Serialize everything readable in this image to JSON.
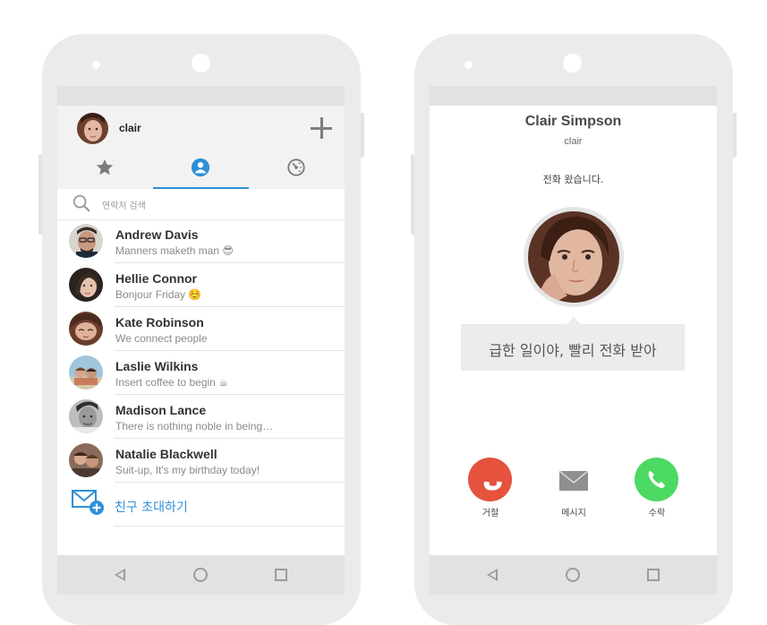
{
  "contacts_screen": {
    "profile": {
      "name": "clair"
    },
    "tabs": [
      {
        "icon": "star-icon",
        "active": false
      },
      {
        "icon": "person-icon",
        "active": true
      },
      {
        "icon": "recent-dial-icon",
        "active": false
      }
    ],
    "search": {
      "placeholder": "연락처 검색"
    },
    "contacts": [
      {
        "name": "Andrew Davis",
        "status": "Manners maketh man 😎"
      },
      {
        "name": "Hellie Connor",
        "status": "Bonjour Friday ☺️"
      },
      {
        "name": "Kate Robinson",
        "status": "We connect people"
      },
      {
        "name": "Laslie Wilkins",
        "status": "Insert coffee to begin ☕"
      },
      {
        "name": "Madison Lance",
        "status": "There is nothing noble in being…"
      },
      {
        "name": "Natalie Blackwell",
        "status": "Suit-up, It's my birthday today!"
      }
    ],
    "invite": {
      "label": "친구 초대하기"
    }
  },
  "call_screen": {
    "caller_name": "Clair Simpson",
    "caller_sub": "clair",
    "incoming_text": "전화 왔습니다.",
    "message": "급한 일이야, 빨리 전화 받아",
    "actions": [
      {
        "label": "거절",
        "icon": "decline-phone-icon",
        "color": "#e5523d"
      },
      {
        "label": "메시지",
        "icon": "envelope-icon",
        "color": "#8f8f8f"
      },
      {
        "label": "수락",
        "icon": "accept-phone-icon",
        "color": "#4cd964"
      }
    ]
  },
  "colors": {
    "accent": "#2f8fd8",
    "decline": "#e5523d",
    "accept": "#4cd964"
  }
}
